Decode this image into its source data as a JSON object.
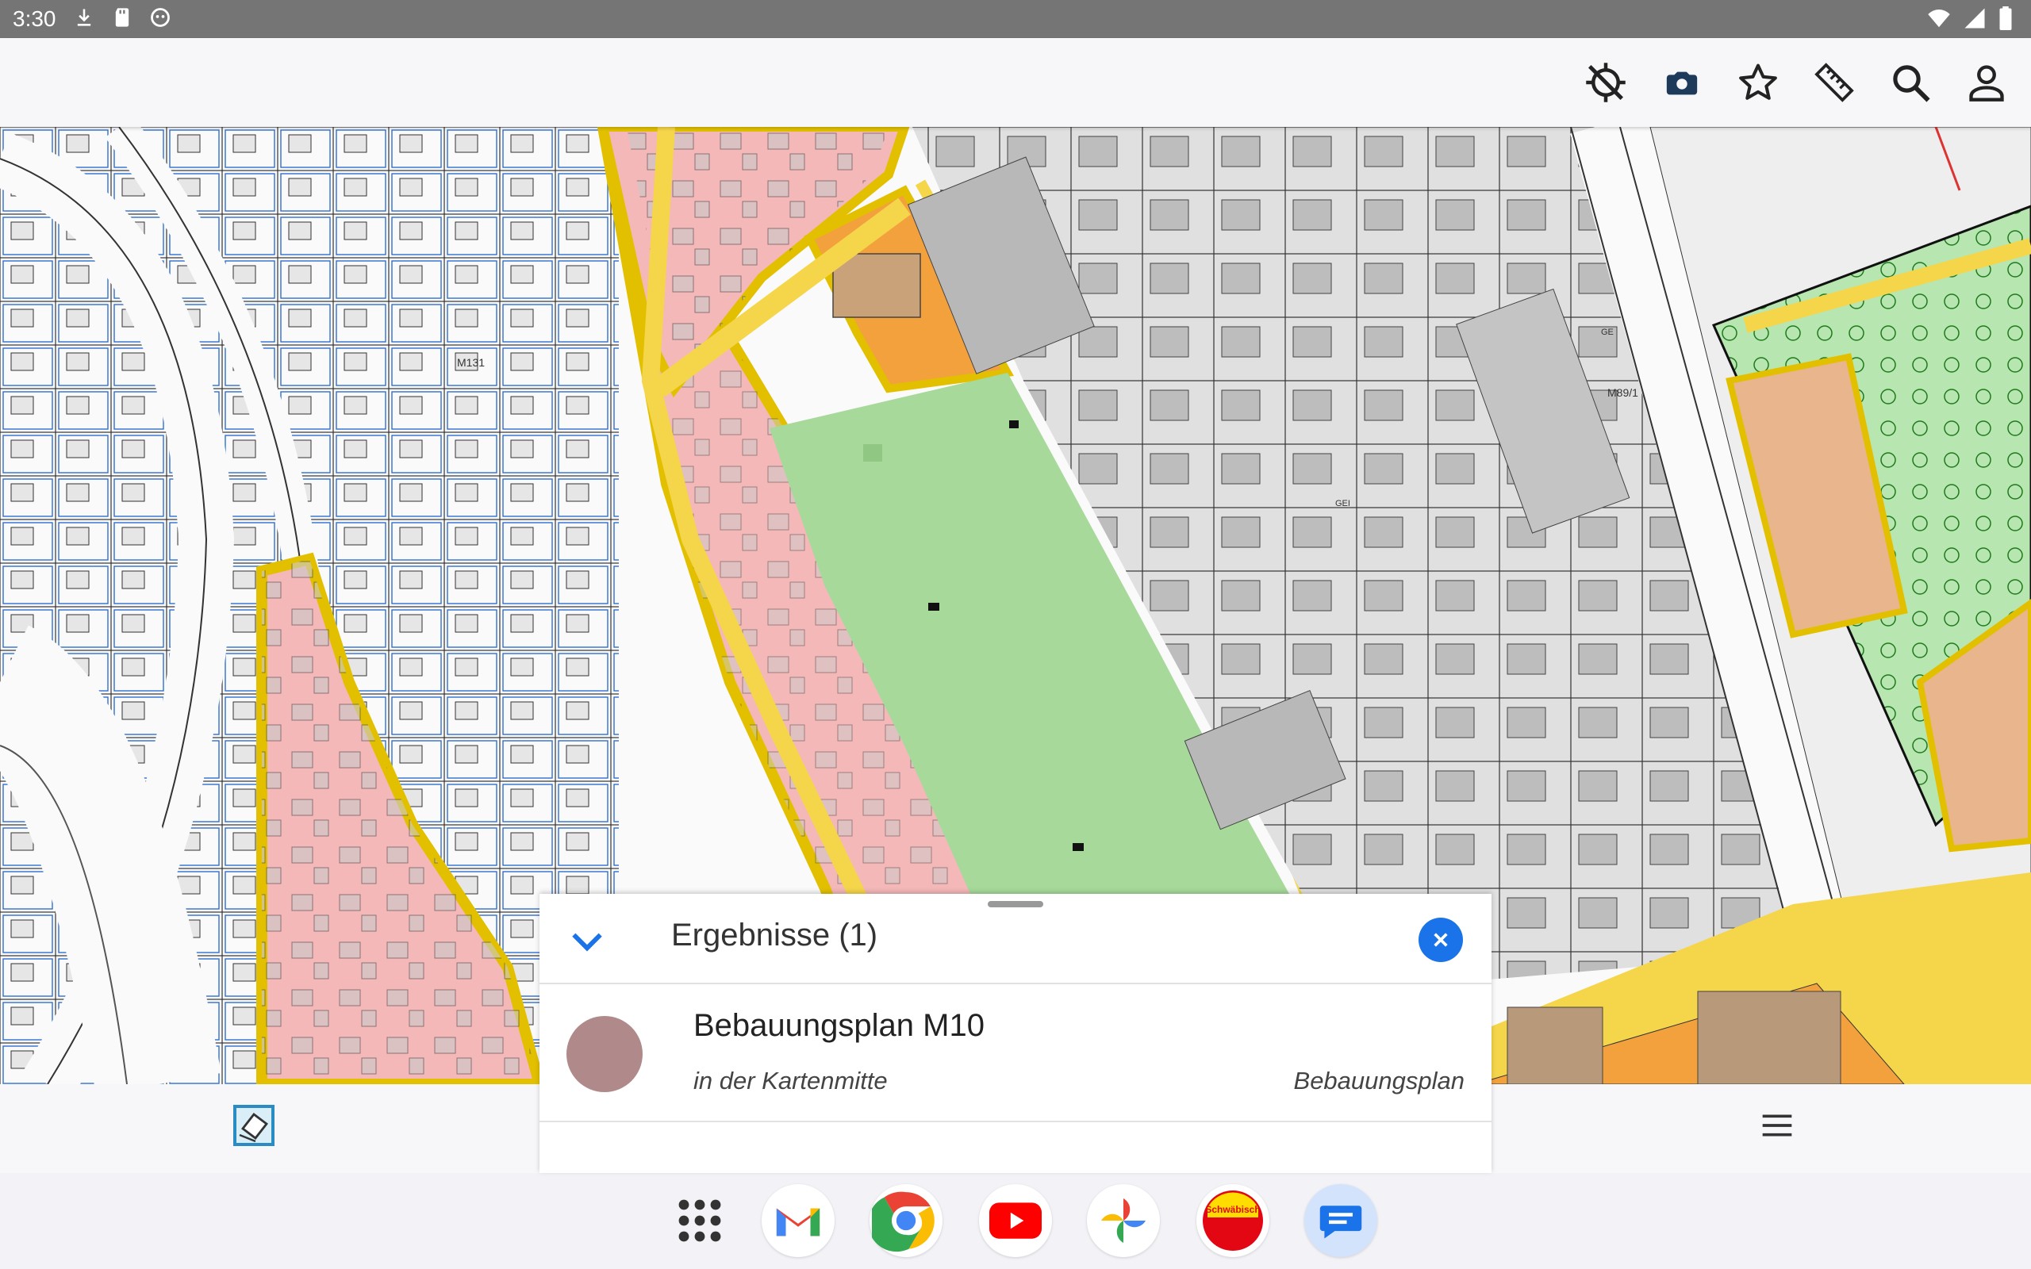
{
  "status_bar": {
    "time": "3:30",
    "left_icons": [
      "download-icon",
      "sd-card-icon",
      "android-icon"
    ],
    "right_icons": [
      "wifi-icon",
      "signal-icon",
      "battery-icon"
    ]
  },
  "toolbar": {
    "buttons": [
      "location-off-icon",
      "camera-icon",
      "star-icon",
      "ruler-icon",
      "search-icon",
      "account-icon"
    ]
  },
  "map": {
    "labels": [
      "M131",
      "M89/1",
      "GE",
      "GEI"
    ]
  },
  "results_panel": {
    "title": "Ergebnisse (1)",
    "results": [
      {
        "title": "Bebauungsplan M10",
        "subtitle": "in der Kartenmitte",
        "type": "Bebauungsplan",
        "dot_color": "#b08a8a"
      }
    ]
  },
  "bottom_bar": {
    "left_button": "layers-icon",
    "right_button": "menu-icon"
  },
  "dock": {
    "apps": [
      "app-drawer",
      "gmail",
      "chrome",
      "youtube",
      "photos",
      "Schwäbisch",
      "messages"
    ]
  },
  "colors": {
    "accent": "#1a73e8",
    "green_area": "#a6d99a",
    "pink_area": "#f2b3b3",
    "orange_area": "#f0a040",
    "road_yellow": "#f5d54a",
    "building_gray": "#c8c8c8"
  }
}
